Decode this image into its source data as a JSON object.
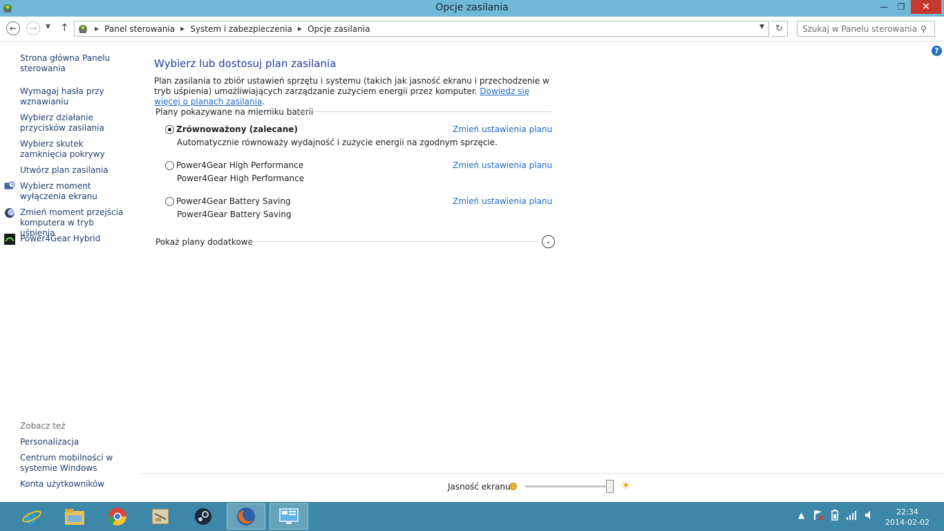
{
  "window": {
    "title": "Opcje zasilania",
    "controls": {
      "minimize": "—",
      "maximize": "❐",
      "close": "✕"
    }
  },
  "nav": {
    "back_icon": "back-arrow-icon",
    "forward_icon": "forward-arrow-icon",
    "breadcrumb": [
      "Panel sterowania",
      "System i zabezpieczenia",
      "Opcje zasilania"
    ],
    "search_placeholder": "Szukaj w Panelu sterowania"
  },
  "sidebar": {
    "items": [
      {
        "label": "Strona główna Panelu sterowania",
        "icon": ""
      },
      {
        "label": "Wymagaj hasła przy wznawianiu",
        "icon": ""
      },
      {
        "label": "Wybierz działanie przycisków zasilania",
        "icon": ""
      },
      {
        "label": "Wybierz skutek zamknięcia pokrywy",
        "icon": ""
      },
      {
        "label": "Utwórz plan zasilania",
        "icon": ""
      },
      {
        "label": "Wybierz moment wyłączenia ekranu",
        "icon": "monitor-clock-icon"
      },
      {
        "label": "Zmień moment przejścia komputera w tryb uśpienia",
        "icon": "moon-icon"
      },
      {
        "label": "Power4Gear Hybrid",
        "icon": "power4gear-icon"
      }
    ],
    "see_also_title": "Zobacz też",
    "see_also": [
      "Personalizacja",
      "Centrum mobilności w systemie Windows",
      "Konta użytkowników"
    ]
  },
  "main": {
    "heading": "Wybierz lub dostosuj plan zasilania",
    "description": "Plan zasilania to zbiór ustawień sprzętu i systemu (takich jak jasność ekranu i przechodzenie w tryb uśpienia) umożliwiających zarządzanie zużyciem energii przez komputer. ",
    "description_link": "Dowiedz się więcej o planach zasilania",
    "description_end": ".",
    "group_title": "Plany pokazywane na mierniku baterii",
    "plans": [
      {
        "name": "Zrównoważony (zalecane)",
        "desc": "Automatycznie równoważy wydajność i zużycie energii na zgodnym sprzęcie.",
        "selected": true,
        "link": "Zmień ustawienia planu"
      },
      {
        "name": "Power4Gear High Performance",
        "desc": "Power4Gear High Performance",
        "selected": false,
        "link": "Zmień ustawienia planu"
      },
      {
        "name": "Power4Gear Battery Saving",
        "desc": "Power4Gear Battery Saving",
        "selected": false,
        "link": "Zmień ustawienia planu"
      }
    ],
    "more_plans": "Pokaż plany dodatkowe"
  },
  "brightness": {
    "label": "Jasność ekranu:",
    "level": 1.0
  },
  "taskbar": {
    "apps": [
      "internet-explorer-icon",
      "file-explorer-icon",
      "chrome-icon",
      "scanner-icon",
      "steam-icon",
      "firefox-icon",
      "control-panel-icon"
    ],
    "active_index": 6,
    "time": "22:34",
    "date": "2014-02-02"
  },
  "colors": {
    "titlebar": "#6fb8d8",
    "taskbar": "#3d88a8",
    "link": "#1a69c4",
    "heading": "#1e3e9e",
    "close": "#c7392d"
  }
}
